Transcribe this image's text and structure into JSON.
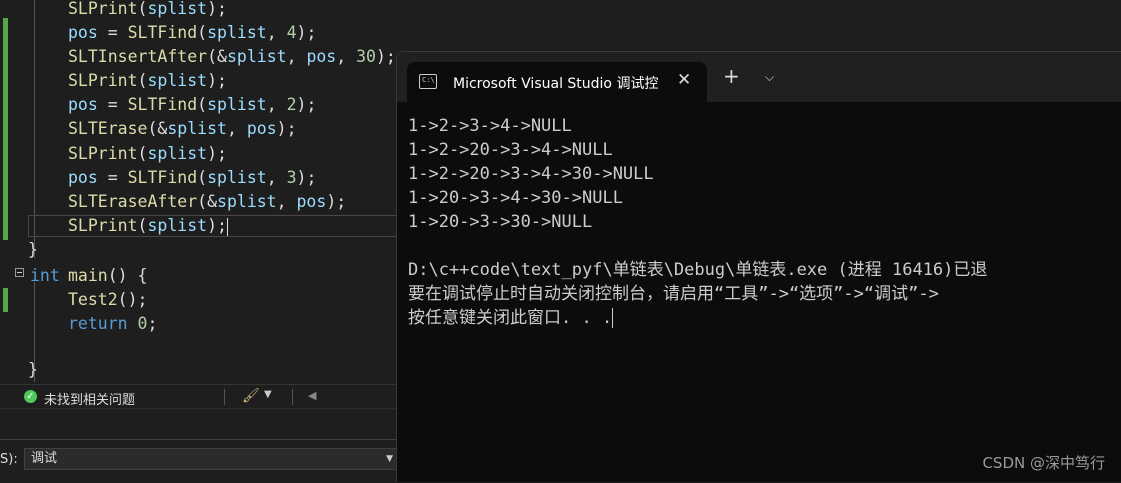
{
  "editor": {
    "lines": {
      "l1": {
        "fn": "SLPrint",
        "arg": "splist"
      },
      "l2": {
        "var": "pos",
        "fn": "SLTFind",
        "arg": "splist",
        "num": "4"
      },
      "l3": {
        "fn": "SLTInsertAfter",
        "arg": "splist",
        "arg2": "pos",
        "num": "30"
      },
      "l4": {
        "fn": "SLPrint",
        "arg": "splist"
      },
      "l5": {
        "var": "pos",
        "fn": "SLTFind",
        "arg": "splist",
        "num": "2"
      },
      "l6": {
        "fn": "SLTErase",
        "arg": "splist",
        "arg2": "pos"
      },
      "l7": {
        "fn": "SLPrint",
        "arg": "splist"
      },
      "l8": {
        "var": "pos",
        "fn": "SLTFind",
        "arg": "splist",
        "num": "3"
      },
      "l9": {
        "fn": "SLTEraseAfter",
        "arg": "splist",
        "arg2": "pos"
      },
      "l10": {
        "fn": "SLPrint",
        "arg": "splist"
      },
      "main_kw": "int",
      "main_sig": "main() {",
      "call": "Test2",
      "return_kw": "return",
      "return_val": "0"
    }
  },
  "status": {
    "issues": "未找到相关问题"
  },
  "output_panel": {
    "show_label": "S):",
    "selected": "调试"
  },
  "terminal": {
    "tab_title": "Microsoft Visual Studio 调试控",
    "icon_label": "C:\\",
    "output": [
      "1->2->3->4->NULL",
      "1->2->20->3->4->NULL",
      "1->2->20->3->4->30->NULL",
      "1->20->3->4->30->NULL",
      "1->20->3->30->NULL",
      "",
      "D:\\c++code\\text_pyf\\单链表\\Debug\\单链表.exe (进程 16416)已退",
      "要在调试停止时自动关闭控制台，请启用“工具”->“选项”->“调试”->",
      "按任意键关闭此窗口. . ."
    ]
  },
  "watermark": "CSDN @深中笃行",
  "colors": {
    "accent_green": "#57a64a",
    "keyword": "#569cd6",
    "function": "#dcdcaa",
    "variable": "#9cdcfe",
    "number": "#b5cea8"
  }
}
